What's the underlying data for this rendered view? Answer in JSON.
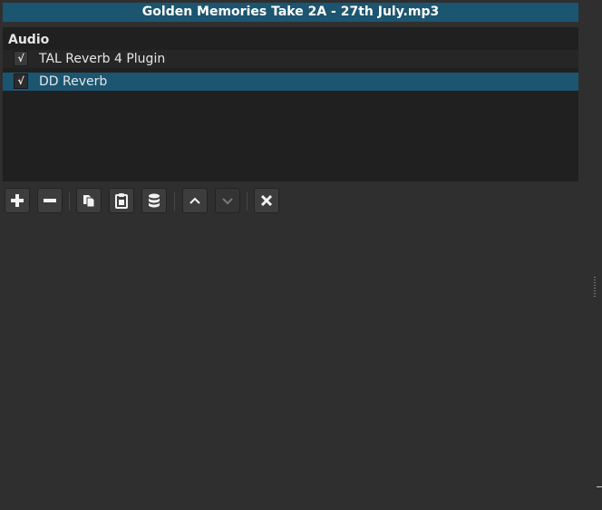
{
  "title": "Golden Memories Take 2A - 27th July.mp3",
  "group_header": "Audio",
  "filters": [
    {
      "label": "TAL Reverb 4 Plugin",
      "checked": true,
      "check_glyph": "√",
      "selected": false
    },
    {
      "label": "DD Reverb",
      "checked": true,
      "check_glyph": "√",
      "selected": true
    }
  ],
  "toolbar": [
    {
      "icon": "plus-icon",
      "enabled": true
    },
    {
      "icon": "minus-icon",
      "enabled": true
    },
    {
      "icon": "copy-icon",
      "enabled": true
    },
    {
      "icon": "paste-icon",
      "enabled": true
    },
    {
      "icon": "database-icon",
      "enabled": true
    },
    {
      "icon": "chevron-up-icon",
      "enabled": true
    },
    {
      "icon": "chevron-down-icon",
      "enabled": false
    },
    {
      "icon": "close-icon",
      "enabled": true
    }
  ],
  "colors": {
    "background": "#2f2f2f",
    "panel": "#202020",
    "accent": "#1c5570",
    "text": "#e6e6e6"
  }
}
